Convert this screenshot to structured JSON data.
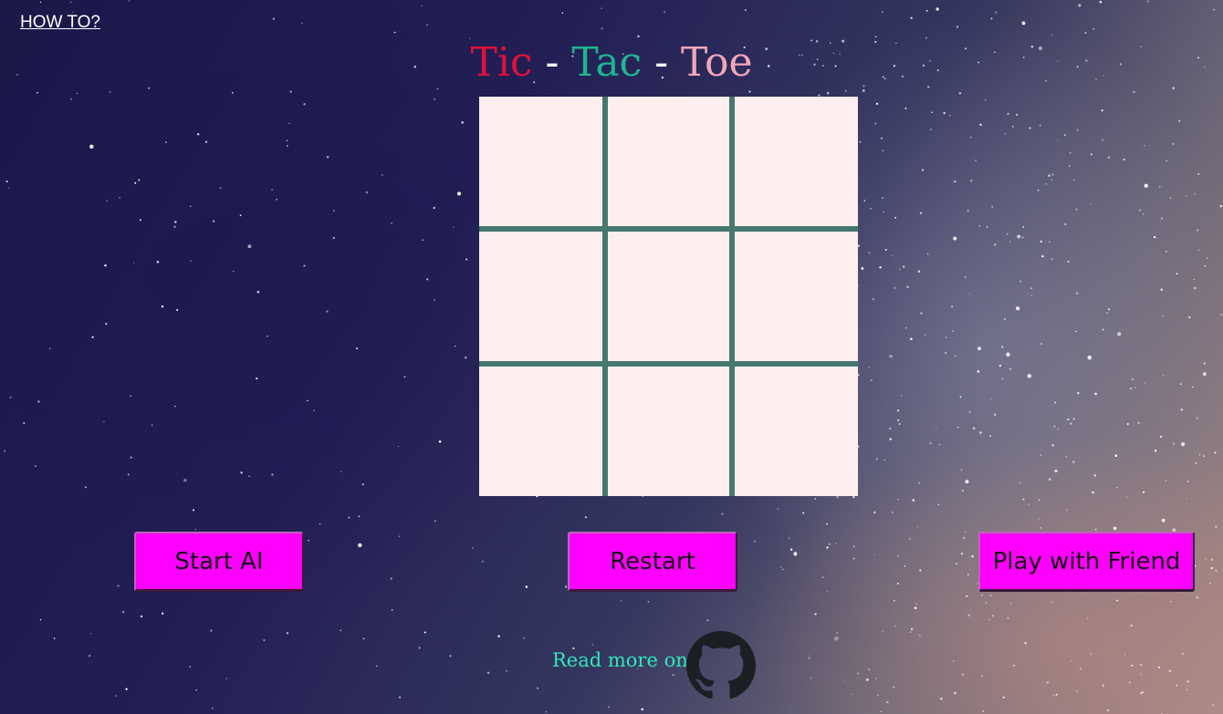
{
  "howto": {
    "label": "HOW TO?"
  },
  "title": {
    "part1": "Tic",
    "sep1": " - ",
    "part2": "Tac",
    "sep2": " - ",
    "part3": "Toe"
  },
  "colors": {
    "tic": "#e0103a",
    "tac": "#1fb592",
    "toe": "#f2a6b8",
    "button": "#ff00ff",
    "board": "#ffeeee",
    "grid": "#467870",
    "readmore": "#2ee8b8"
  },
  "board": {
    "cells": [
      "",
      "",
      "",
      "",
      "",
      "",
      "",
      "",
      ""
    ]
  },
  "buttons": {
    "start_ai": "Start AI",
    "restart": "Restart",
    "play_friend": "Play with Friend"
  },
  "footer": {
    "readmore": "Read more on:",
    "icon": "github-icon"
  }
}
